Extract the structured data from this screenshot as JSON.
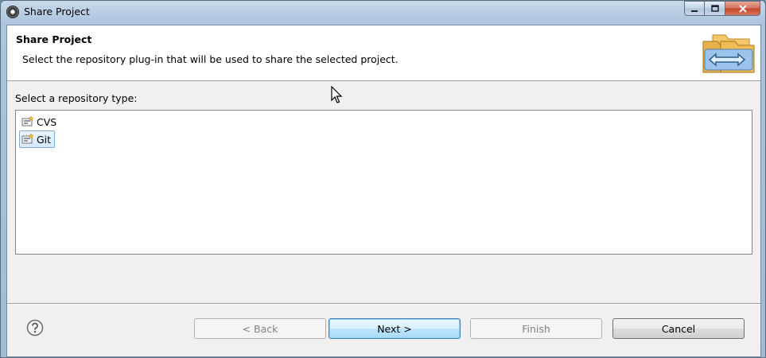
{
  "window": {
    "title": "Share Project"
  },
  "banner": {
    "title": "Share Project",
    "description": "Select the repository plug-in that will be used to share the selected project."
  },
  "repository": {
    "label": "Select a repository type:",
    "items": [
      {
        "label": "CVS",
        "icon": "cvs-repository-icon",
        "selected": false
      },
      {
        "label": "Git",
        "icon": "git-repository-icon",
        "selected": true
      }
    ]
  },
  "buttons": {
    "back": "< Back",
    "next": "Next >",
    "finish": "Finish",
    "cancel": "Cancel"
  },
  "icons": {
    "help": "help-icon",
    "banner": "share-folders-icon"
  }
}
